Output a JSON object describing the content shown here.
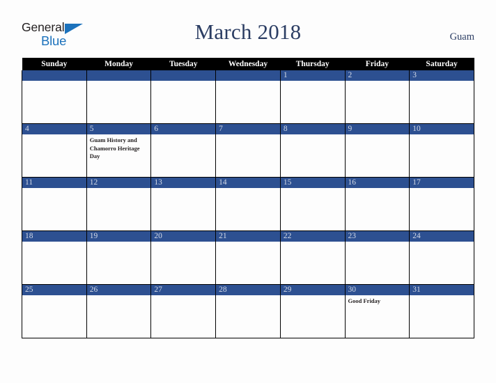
{
  "brand": {
    "word1": "General",
    "word2": "Blue",
    "triangle_color": "#1c72bc",
    "word1_color": "#231f20",
    "word2_color": "#1c72bc"
  },
  "header": {
    "title": "March 2018",
    "locale": "Guam",
    "title_color": "#2b3d63"
  },
  "calendar": {
    "month": "March",
    "year": "2018",
    "header_bg": "#000000",
    "daybar_bg": "#2d5091",
    "cell_bg": "#fdfdfd",
    "weekday_headers": [
      "Sunday",
      "Monday",
      "Tuesday",
      "Wednesday",
      "Thursday",
      "Friday",
      "Saturday"
    ],
    "weeks": [
      [
        {
          "num": "",
          "events": []
        },
        {
          "num": "",
          "events": []
        },
        {
          "num": "",
          "events": []
        },
        {
          "num": "",
          "events": []
        },
        {
          "num": "1",
          "events": []
        },
        {
          "num": "2",
          "events": []
        },
        {
          "num": "3",
          "events": []
        }
      ],
      [
        {
          "num": "4",
          "events": []
        },
        {
          "num": "5",
          "events": [
            "Guam History and Chamorro Heritage Day"
          ]
        },
        {
          "num": "6",
          "events": []
        },
        {
          "num": "7",
          "events": []
        },
        {
          "num": "8",
          "events": []
        },
        {
          "num": "9",
          "events": []
        },
        {
          "num": "10",
          "events": []
        }
      ],
      [
        {
          "num": "11",
          "events": []
        },
        {
          "num": "12",
          "events": []
        },
        {
          "num": "13",
          "events": []
        },
        {
          "num": "14",
          "events": []
        },
        {
          "num": "15",
          "events": []
        },
        {
          "num": "16",
          "events": []
        },
        {
          "num": "17",
          "events": []
        }
      ],
      [
        {
          "num": "18",
          "events": []
        },
        {
          "num": "19",
          "events": []
        },
        {
          "num": "20",
          "events": []
        },
        {
          "num": "21",
          "events": []
        },
        {
          "num": "22",
          "events": []
        },
        {
          "num": "23",
          "events": []
        },
        {
          "num": "24",
          "events": []
        }
      ],
      [
        {
          "num": "25",
          "events": []
        },
        {
          "num": "26",
          "events": []
        },
        {
          "num": "27",
          "events": []
        },
        {
          "num": "28",
          "events": []
        },
        {
          "num": "29",
          "events": []
        },
        {
          "num": "30",
          "events": [
            "Good Friday"
          ]
        },
        {
          "num": "31",
          "events": []
        }
      ]
    ]
  }
}
